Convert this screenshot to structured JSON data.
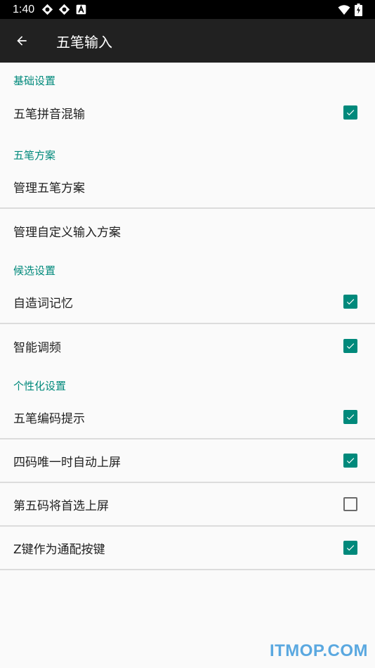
{
  "status_bar": {
    "time": "1:40"
  },
  "app_bar": {
    "title": "五笔输入"
  },
  "sections": [
    {
      "header": "基础设置",
      "items": [
        {
          "label": "五笔拼音混输",
          "checked": true
        }
      ]
    },
    {
      "header": "五笔方案",
      "items": [
        {
          "label": "管理五笔方案"
        },
        {
          "label": "管理自定义输入方案"
        }
      ]
    },
    {
      "header": "候选设置",
      "items": [
        {
          "label": "自造词记忆",
          "checked": true
        },
        {
          "label": "智能调频",
          "checked": true
        }
      ]
    },
    {
      "header": "个性化设置",
      "items": [
        {
          "label": "五笔编码提示",
          "checked": true
        },
        {
          "label": "四码唯一时自动上屏",
          "checked": true
        },
        {
          "label": "第五码将首选上屏",
          "checked": false
        },
        {
          "label": "Z键作为通配按键",
          "checked": true
        }
      ]
    }
  ],
  "colors": {
    "accent": "#00897b",
    "app_bar": "#212121",
    "status_bar": "#000000",
    "background": "#fafafa"
  },
  "watermark": "ITMOP.COM"
}
